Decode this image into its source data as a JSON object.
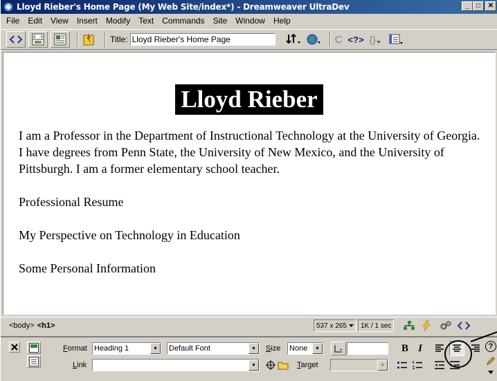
{
  "window": {
    "title": "Lloyd Rieber's Home Page (My Web Site/index*) - Dreamweaver UltraDev",
    "minimize_glyph": "_",
    "maximize_glyph": "□",
    "close_glyph": "✕"
  },
  "menu": [
    "File",
    "Edit",
    "View",
    "Insert",
    "Modify",
    "Text",
    "Commands",
    "Site",
    "Window",
    "Help"
  ],
  "toolbar": {
    "title_label": "Title:",
    "title_value": "Lloyd Rieber's Home Page",
    "code_view_icon": "code-view-icon",
    "split_view_icon": "split-view-icon",
    "design_view_icon": "design-view-icon",
    "refresh_glyph": "C",
    "code_glyph": "<?>",
    "braces_glyph": "{}"
  },
  "document": {
    "heading": "Lloyd Rieber",
    "paragraph": "I am a Professor in the Department of Instructional Technology at the University of Georgia. I have degrees from Penn State, the University of New Mexico, and the University of Pittsburgh. I am a former elementary school teacher.",
    "links": [
      "Professional Resume",
      "My Perspective on Technology in Education",
      "Some Personal Information"
    ]
  },
  "status": {
    "tag_body": "<body>",
    "tag_h1": "<h1>",
    "window_size": "537 x 265",
    "download": "1K / 1 sec"
  },
  "properties": {
    "format_label_u": "F",
    "format_label_rest": "ormat",
    "format_value": "Heading 1",
    "font_value": "Default Font",
    "size_label_u": "S",
    "size_label_rest": "ize",
    "size_value": "None",
    "link_label_u": "L",
    "link_label_rest": "ink",
    "link_value": "",
    "target_label_u": "T",
    "target_label_rest": "arget",
    "target_value": "",
    "bold": "B",
    "italic": "I",
    "help_glyph": "?"
  },
  "colors": {
    "title_gradient_start": "#0a246a",
    "title_gradient_end": "#3a6ea5",
    "chrome": "#d4d0c8",
    "heading_bg": "#000000",
    "heading_fg": "#ffffff"
  }
}
